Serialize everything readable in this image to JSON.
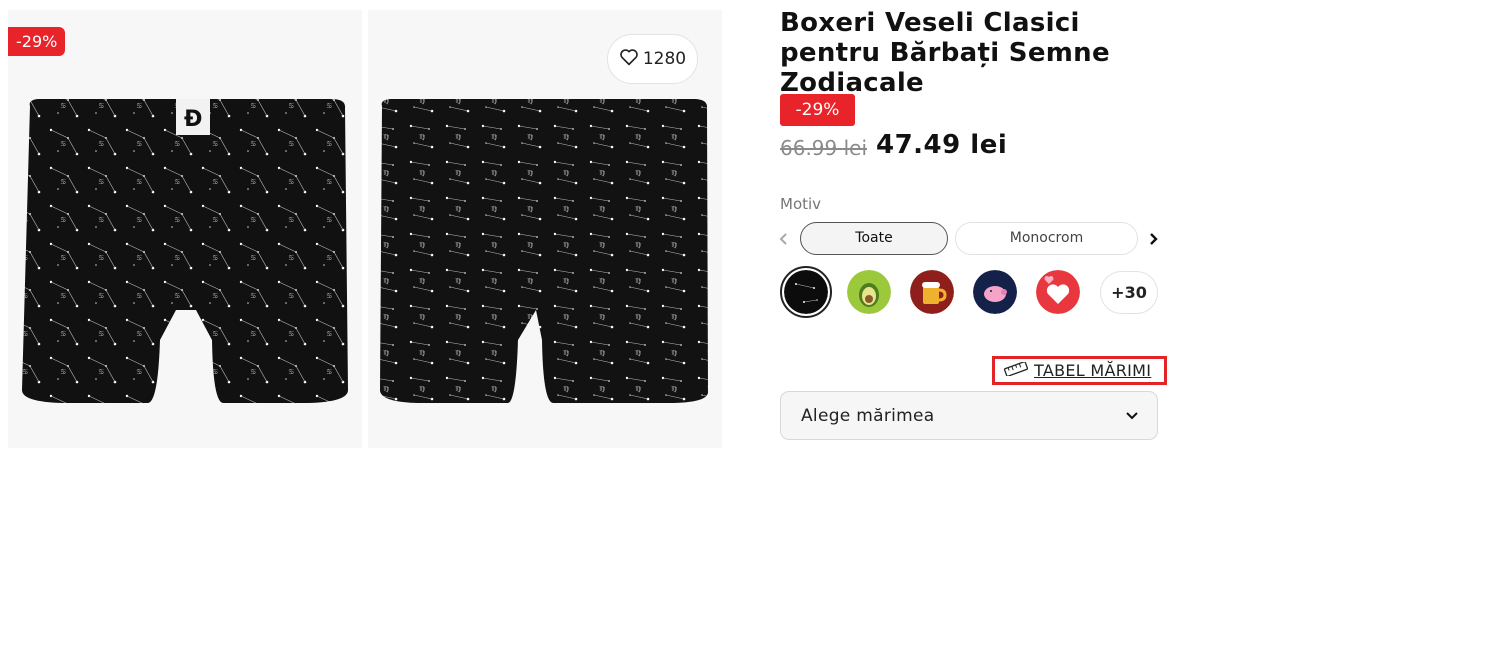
{
  "gallery": {
    "discount_badge": "-29%",
    "wishlist_count": "1280"
  },
  "product": {
    "title": "Boxeri Veseli Clasici pentru Bărbați Semne Zodiacale",
    "discount_badge": "-29%",
    "old_price": "66.99 lei",
    "new_price": "47.49 lei"
  },
  "motif": {
    "label": "Motiv",
    "filters": [
      "Toate",
      "Monocrom"
    ],
    "selected_filter": "Toate",
    "swatches": [
      "zodiac",
      "avocado",
      "beer",
      "pig",
      "hearts"
    ],
    "more_label": "+30"
  },
  "size": {
    "table_link": "TABEL MĂRIMI",
    "select_label": "Alege mărimea"
  },
  "colors": {
    "accent_red": "#e8232a",
    "highlight_border": "#e32326"
  }
}
